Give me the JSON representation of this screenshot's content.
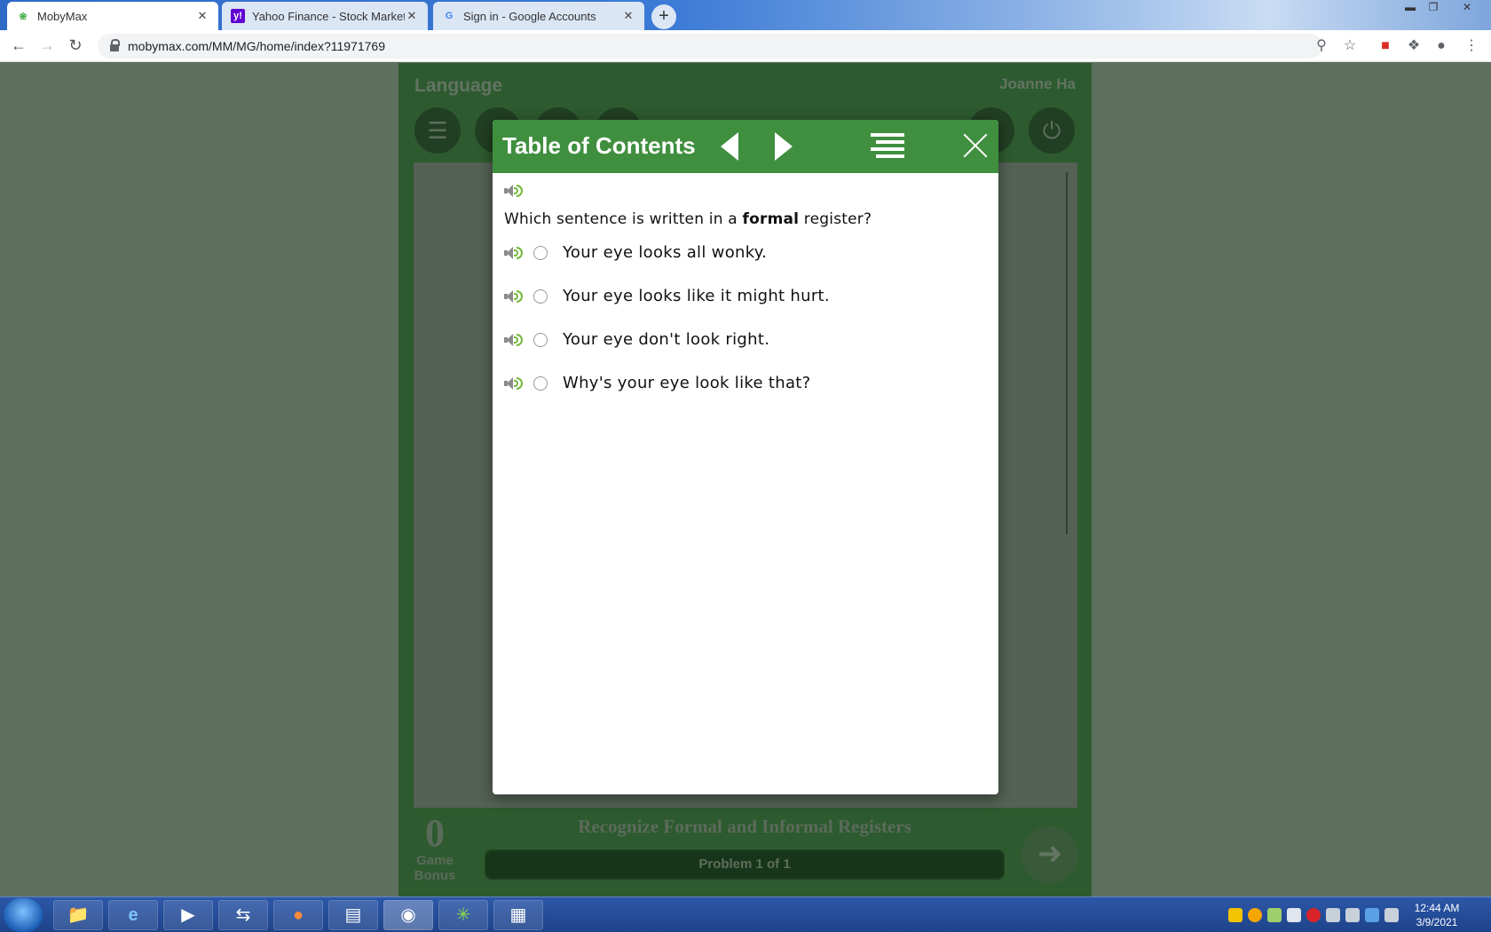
{
  "browser": {
    "tabs": [
      {
        "title": "MobyMax",
        "active": true
      },
      {
        "title": "Yahoo Finance - Stock Market Liv",
        "active": false
      },
      {
        "title": "Sign in - Google Accounts",
        "active": false
      }
    ],
    "url": "mobymax.com/MM/MG/home/index?11971769",
    "new_tab_glyph": "+"
  },
  "app": {
    "subject": "Language",
    "user": "Joanne Ha",
    "game_bonus_value": "0",
    "game_bonus_label_1": "Game",
    "game_bonus_label_2": "Bonus",
    "skill_title": "Recognize Formal and Informal Registers",
    "progress_text": "Problem 1 of 1",
    "colors": {
      "brand_green": "#3f8f3f",
      "speaker_wave": "#74b83c"
    }
  },
  "modal": {
    "title": "Table of Contents",
    "question_before": "Which sentence is written in a ",
    "question_bold": "formal",
    "question_after": " register?",
    "choices": [
      "Your eye looks all wonky.",
      "Your eye looks like it might hurt.",
      "Your eye don't look right.",
      "Why's your eye look like that?"
    ]
  },
  "taskbar": {
    "time": "12:44 AM",
    "date": "3/9/2021"
  }
}
